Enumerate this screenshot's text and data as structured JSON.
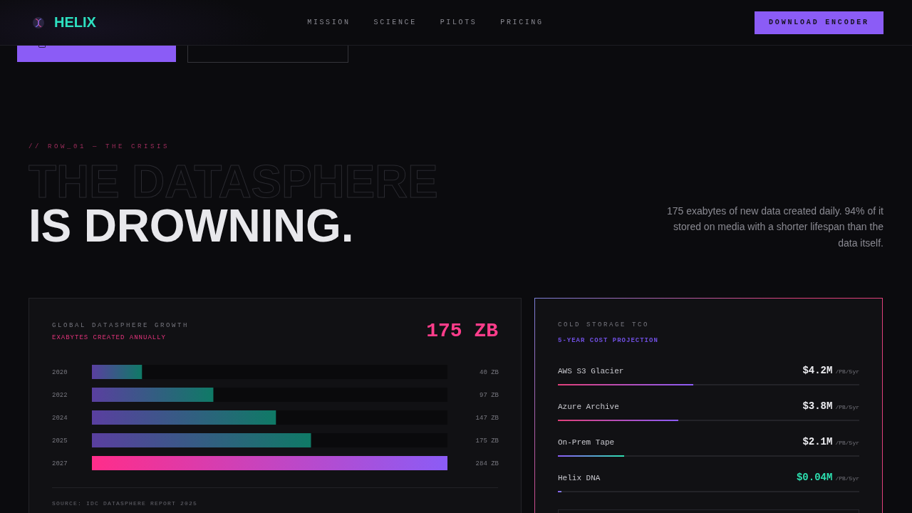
{
  "header": {
    "logo": "HELIX",
    "nav": [
      "MISSION",
      "SCIENCE",
      "PILOTS",
      "PRICING"
    ],
    "cta": "DOWNLOAD ENCODER"
  },
  "hero": {
    "eyebrow": "// ROW_01 — THE CRISIS",
    "headline_outline": "THE DATASPHERE",
    "headline": "IS DROWNING.",
    "summary": "175 exabytes of new data created daily. 94% of it stored on media with a shorter lifespan than the data itself."
  },
  "growth_card": {
    "title": "GLOBAL DATASPHERE GROWTH",
    "subtitle": "EXABYTES CREATED ANNUALLY",
    "total": "175 ZB",
    "chart_data": [
      {
        "type": "bar",
        "orientation": "horizontal",
        "categories": [
          "2020",
          "2022",
          "2024",
          "2025",
          "2027"
        ],
        "values": [
          40,
          97,
          147,
          175,
          284
        ],
        "colors": [
          "#5a3fa0",
          "#5a3fa0",
          "#5a3fa0",
          "#5a3fa0",
          "#ff2d8a"
        ],
        "value_labels": [
          "40 ZB",
          "97 ZB",
          "147 ZB",
          "175 ZB",
          "284 ZB"
        ]
      }
    ],
    "source": "SOURCE: IDC DATASPHERE REPORT 2025"
  },
  "cost_card": {
    "title": "COLD STORAGE TCO",
    "subtitle": "5-YEAR COST PROJECTION",
    "rows": [
      {
        "kind": "cloud",
        "name": "AWS S3 Glacier",
        "value": "$4.2M",
        "unit": "/PB/5yr",
        "level": 0.45
      },
      {
        "kind": "cloud",
        "name": "Azure Archive",
        "value": "$3.8M",
        "unit": "/PB/5yr",
        "level": 0.4
      },
      {
        "kind": "tape",
        "name": "On-Prem Tape",
        "value": "$2.1M",
        "unit": "/PB/5yr",
        "level": 0.22
      },
      {
        "kind": "dna",
        "name": "Helix DNA",
        "value": "$0.04M",
        "unit": "/PB/5yr",
        "level": 0.012
      }
    ]
  }
}
